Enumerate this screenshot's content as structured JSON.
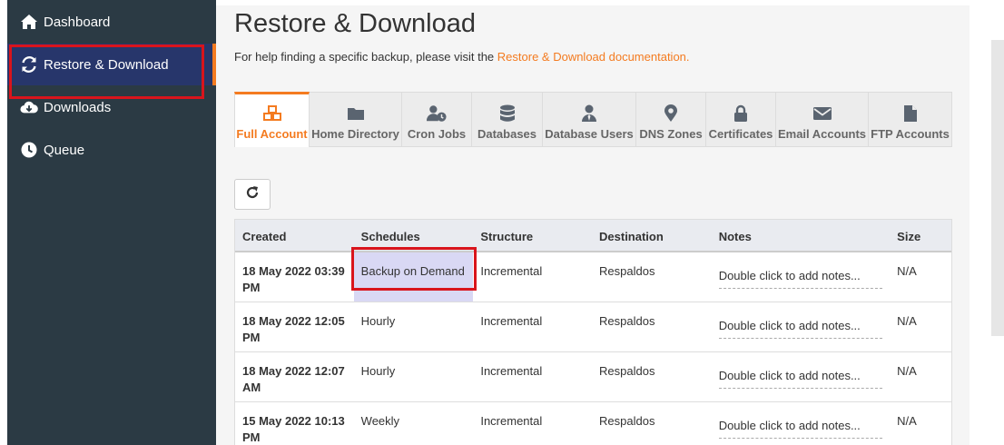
{
  "sidebar": {
    "items": [
      {
        "label": "Dashboard",
        "icon": "home-icon"
      },
      {
        "label": "Restore & Download",
        "icon": "sync-icon",
        "active": true
      },
      {
        "label": "Downloads",
        "icon": "cloud-download-icon"
      },
      {
        "label": "Queue",
        "icon": "clock-icon"
      }
    ]
  },
  "main": {
    "title": "Restore & Download",
    "help_text": "For help finding a specific backup, please visit the ",
    "help_link": "Restore & Download documentation."
  },
  "tabs": [
    {
      "label": "Full Account",
      "icon": "cubes-icon",
      "active": true
    },
    {
      "label": "Home Directory",
      "icon": "folder-icon"
    },
    {
      "label": "Cron Jobs",
      "icon": "user-clock-icon"
    },
    {
      "label": "Databases",
      "icon": "database-icon"
    },
    {
      "label": "Database Users",
      "icon": "user-tie-icon"
    },
    {
      "label": "DNS Zones",
      "icon": "map-marker-icon"
    },
    {
      "label": "Certificates",
      "icon": "lock-icon"
    },
    {
      "label": "Email Accounts",
      "icon": "envelope-icon"
    },
    {
      "label": "FTP Accounts",
      "icon": "file-icon"
    }
  ],
  "table": {
    "headers": [
      "Created",
      "Schedules",
      "Structure",
      "Destination",
      "Notes",
      "Size"
    ],
    "rows": [
      {
        "created_1": "18 May 2022 03:39",
        "created_2": "PM",
        "schedule": "Backup on Demand",
        "structure": "Incremental",
        "destination": "Respaldos",
        "notes": "Double click to add notes...",
        "size": "N/A"
      },
      {
        "created_1": "18 May 2022 12:05",
        "created_2": "PM",
        "schedule": "Hourly",
        "structure": "Incremental",
        "destination": "Respaldos",
        "notes": "Double click to add notes...",
        "size": "N/A"
      },
      {
        "created_1": "18 May 2022 12:07",
        "created_2": "AM",
        "schedule": "Hourly",
        "structure": "Incremental",
        "destination": "Respaldos",
        "notes": "Double click to add notes...",
        "size": "N/A"
      },
      {
        "created_1": "15 May 2022 10:13",
        "created_2": "PM",
        "schedule": "Weekly",
        "structure": "Incremental",
        "destination": "Respaldos",
        "notes": "Double click to add notes...",
        "size": "N/A"
      }
    ]
  },
  "colors": {
    "accent": "#f47b20",
    "sidebar_bg": "#2b3a44",
    "highlight": "#d9141c"
  }
}
